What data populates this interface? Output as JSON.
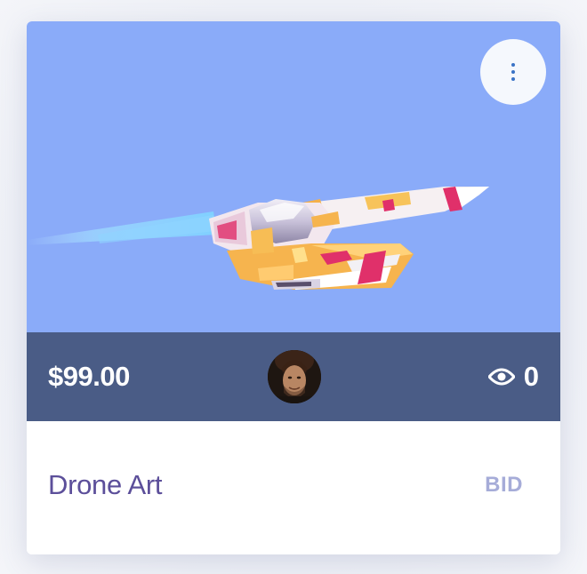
{
  "card": {
    "price": "$99.00",
    "views_count": "0",
    "title": "Drone Art",
    "bid_label": "BID"
  },
  "icons": {
    "menu": "more-vertical-icon",
    "views": "eye-icon"
  },
  "colors": {
    "image_background": "#8aabf9",
    "stats_bar": "#4a5c86",
    "title_text": "#5c4f9a",
    "bid_text": "#a6acd8",
    "menu_dots": "#3a73c6"
  }
}
